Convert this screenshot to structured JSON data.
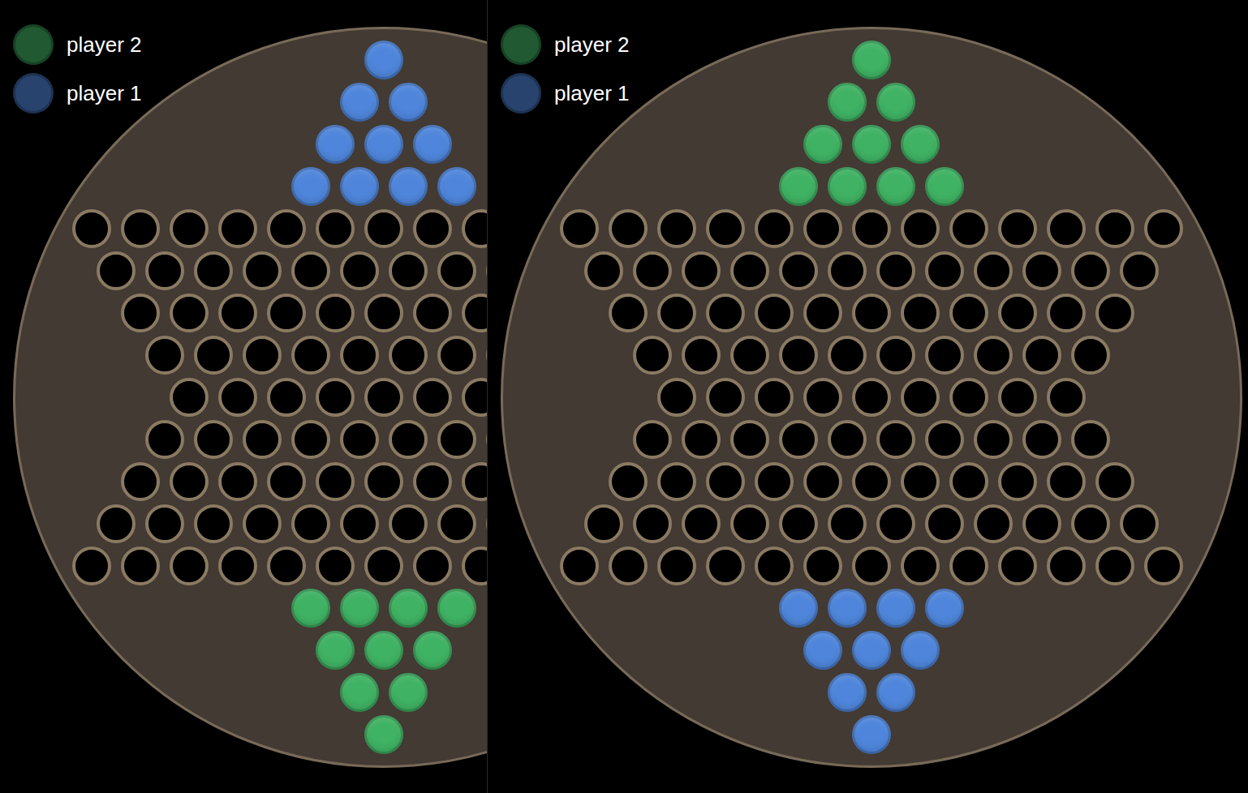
{
  "panels": [
    {
      "legend": [
        {
          "label": "player 2",
          "color": "#3fb263"
        },
        {
          "label": "player 1",
          "color": "#4f86db"
        }
      ],
      "board": {
        "rows": [
          [
            "player 1"
          ],
          [
            "player 1",
            "player 1"
          ],
          [
            "player 1",
            "player 1",
            "player 1"
          ],
          [
            "player 1",
            "player 1",
            "player 1",
            "player 1"
          ],
          [
            "",
            "",
            "",
            "",
            "",
            "",
            "",
            "",
            "",
            "",
            "",
            "",
            ""
          ],
          [
            "",
            "",
            "",
            "",
            "",
            "",
            "",
            "",
            "",
            "",
            "",
            ""
          ],
          [
            "",
            "",
            "",
            "",
            "",
            "",
            "",
            "",
            "",
            "",
            ""
          ],
          [
            "",
            "",
            "",
            "",
            "",
            "",
            "",
            "",
            "",
            ""
          ],
          [
            "",
            "",
            "",
            "",
            "",
            "",
            "",
            "",
            ""
          ],
          [
            "",
            "",
            "",
            "",
            "",
            "",
            "",
            "",
            "",
            ""
          ],
          [
            "",
            "",
            "",
            "",
            "",
            "",
            "",
            "",
            "",
            "",
            ""
          ],
          [
            "",
            "",
            "",
            "",
            "",
            "",
            "",
            "",
            "",
            "",
            "",
            ""
          ],
          [
            "",
            "",
            "",
            "",
            "",
            "",
            "",
            "",
            "",
            "",
            "",
            "",
            ""
          ],
          [
            "player 2",
            "player 2",
            "player 2",
            "player 2"
          ],
          [
            "player 2",
            "player 2",
            "player 2"
          ],
          [
            "player 2",
            "player 2"
          ],
          [
            "player 2"
          ]
        ]
      }
    },
    {
      "legend": [
        {
          "label": "player 2",
          "color": "#3fb263"
        },
        {
          "label": "player 1",
          "color": "#4f86db"
        }
      ],
      "board": {
        "rows": [
          [
            "player 2"
          ],
          [
            "player 2",
            "player 2"
          ],
          [
            "player 2",
            "player 2",
            "player 2"
          ],
          [
            "player 2",
            "player 2",
            "player 2",
            "player 2"
          ],
          [
            "",
            "",
            "",
            "",
            "",
            "",
            "",
            "",
            "",
            "",
            "",
            "",
            ""
          ],
          [
            "",
            "",
            "",
            "",
            "",
            "",
            "",
            "",
            "",
            "",
            "",
            ""
          ],
          [
            "",
            "",
            "",
            "",
            "",
            "",
            "",
            "",
            "",
            "",
            ""
          ],
          [
            "",
            "",
            "",
            "",
            "",
            "",
            "",
            "",
            "",
            ""
          ],
          [
            "",
            "",
            "",
            "",
            "",
            "",
            "",
            "",
            ""
          ],
          [
            "",
            "",
            "",
            "",
            "",
            "",
            "",
            "",
            "",
            ""
          ],
          [
            "",
            "",
            "",
            "",
            "",
            "",
            "",
            "",
            "",
            "",
            ""
          ],
          [
            "",
            "",
            "",
            "",
            "",
            "",
            "",
            "",
            "",
            "",
            "",
            ""
          ],
          [
            "",
            "",
            "",
            "",
            "",
            "",
            "",
            "",
            "",
            "",
            "",
            "",
            ""
          ],
          [
            "player 1",
            "player 1",
            "player 1",
            "player 1"
          ],
          [
            "player 1",
            "player 1",
            "player 1"
          ],
          [
            "player 1",
            "player 1"
          ],
          [
            "player 1"
          ]
        ]
      }
    }
  ]
}
